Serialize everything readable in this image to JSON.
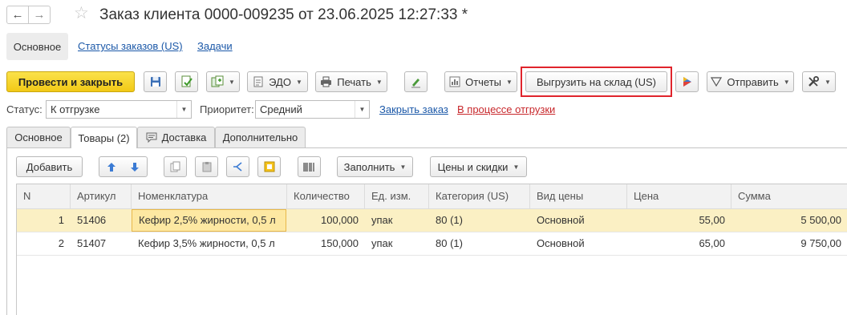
{
  "window": {
    "title": "Заказ клиента 0000-009235 от 23.06.2025 12:27:33 *"
  },
  "sections": {
    "main": "Основное",
    "order_statuses": "Статусы заказов (US)",
    "tasks": "Задачи"
  },
  "toolbar": {
    "post_close": "Провести и закрыть",
    "edo": "ЭДО",
    "print": "Печать",
    "reports": "Отчеты",
    "export_warehouse": "Выгрузить на склад (US)",
    "send": "Отправить"
  },
  "status_row": {
    "status_label": "Статус:",
    "status_value": "К отгрузке",
    "priority_label": "Приоритет:",
    "priority_value": "Средний",
    "close_order": "Закрыть заказ",
    "shipping_state": "В процессе отгрузки"
  },
  "tabs": [
    "Основное",
    "Товары (2)",
    "Доставка",
    "Дополнительно"
  ],
  "goods_toolbar": {
    "add": "Добавить",
    "fill": "Заполнить",
    "prices_discounts": "Цены и скидки"
  },
  "table": {
    "columns": [
      "N",
      "Артикул",
      "Номенклатура",
      "Количество",
      "Ед. изм.",
      "Категория (US)",
      "Вид цены",
      "Цена",
      "Сумма"
    ],
    "rows": [
      {
        "n": "1",
        "sku": "51406",
        "name": "Кефир 2,5% жирности, 0,5 л",
        "qty": "100,000",
        "unit": "упак",
        "category": "80 (1)",
        "price_type": "Основной",
        "price": "55,00",
        "sum": "5 500,00"
      },
      {
        "n": "2",
        "sku": "51407",
        "name": "Кефир 3,5% жирности, 0,5 л",
        "qty": "150,000",
        "unit": "упак",
        "category": "80 (1)",
        "price_type": "Основной",
        "price": "65,00",
        "sum": "9 750,00"
      }
    ]
  },
  "colors": {
    "primary_button": "#f2c916",
    "highlight_frame": "#e0242c",
    "link": "#1b58a8",
    "selected_row": "#fbf0c4"
  }
}
